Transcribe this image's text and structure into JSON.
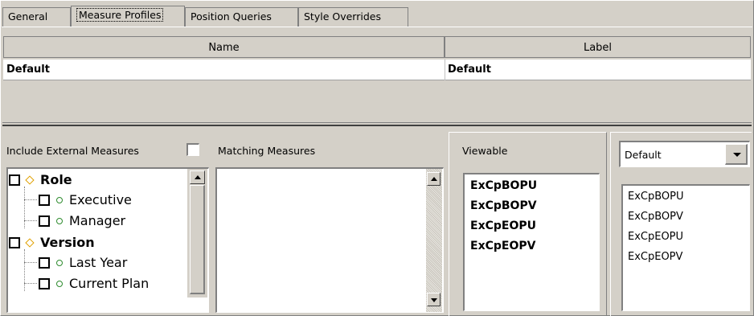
{
  "tabs": [
    {
      "label": "General"
    },
    {
      "label": "Measure Profiles"
    },
    {
      "label": "Position Queries"
    },
    {
      "label": "Style Overrides"
    }
  ],
  "table": {
    "headers": {
      "name": "Name",
      "label": "Label"
    },
    "rows": [
      {
        "name": "Default",
        "label": "Default"
      }
    ]
  },
  "include_external": {
    "label": "Include External Measures",
    "checked": false
  },
  "matching": {
    "label": "Matching Measures",
    "items": []
  },
  "tree": [
    {
      "label": "Role",
      "level": 0,
      "checked": false
    },
    {
      "label": "Executive",
      "level": 1,
      "checked": false
    },
    {
      "label": "Manager",
      "level": 1,
      "checked": false
    },
    {
      "label": "Version",
      "level": 0,
      "checked": false
    },
    {
      "label": "Last Year",
      "level": 1,
      "checked": false
    },
    {
      "label": "Current Plan",
      "level": 1,
      "checked": false
    }
  ],
  "viewable": {
    "label": "Viewable",
    "items": [
      "ExCpBOPU",
      "ExCpBOPV",
      "ExCpEOPU",
      "ExCpEOPV"
    ]
  },
  "profile_select": {
    "value": "Default",
    "items": [
      "ExCpBOPU",
      "ExCpBOPV",
      "ExCpEOPU",
      "ExCpEOPV"
    ]
  }
}
